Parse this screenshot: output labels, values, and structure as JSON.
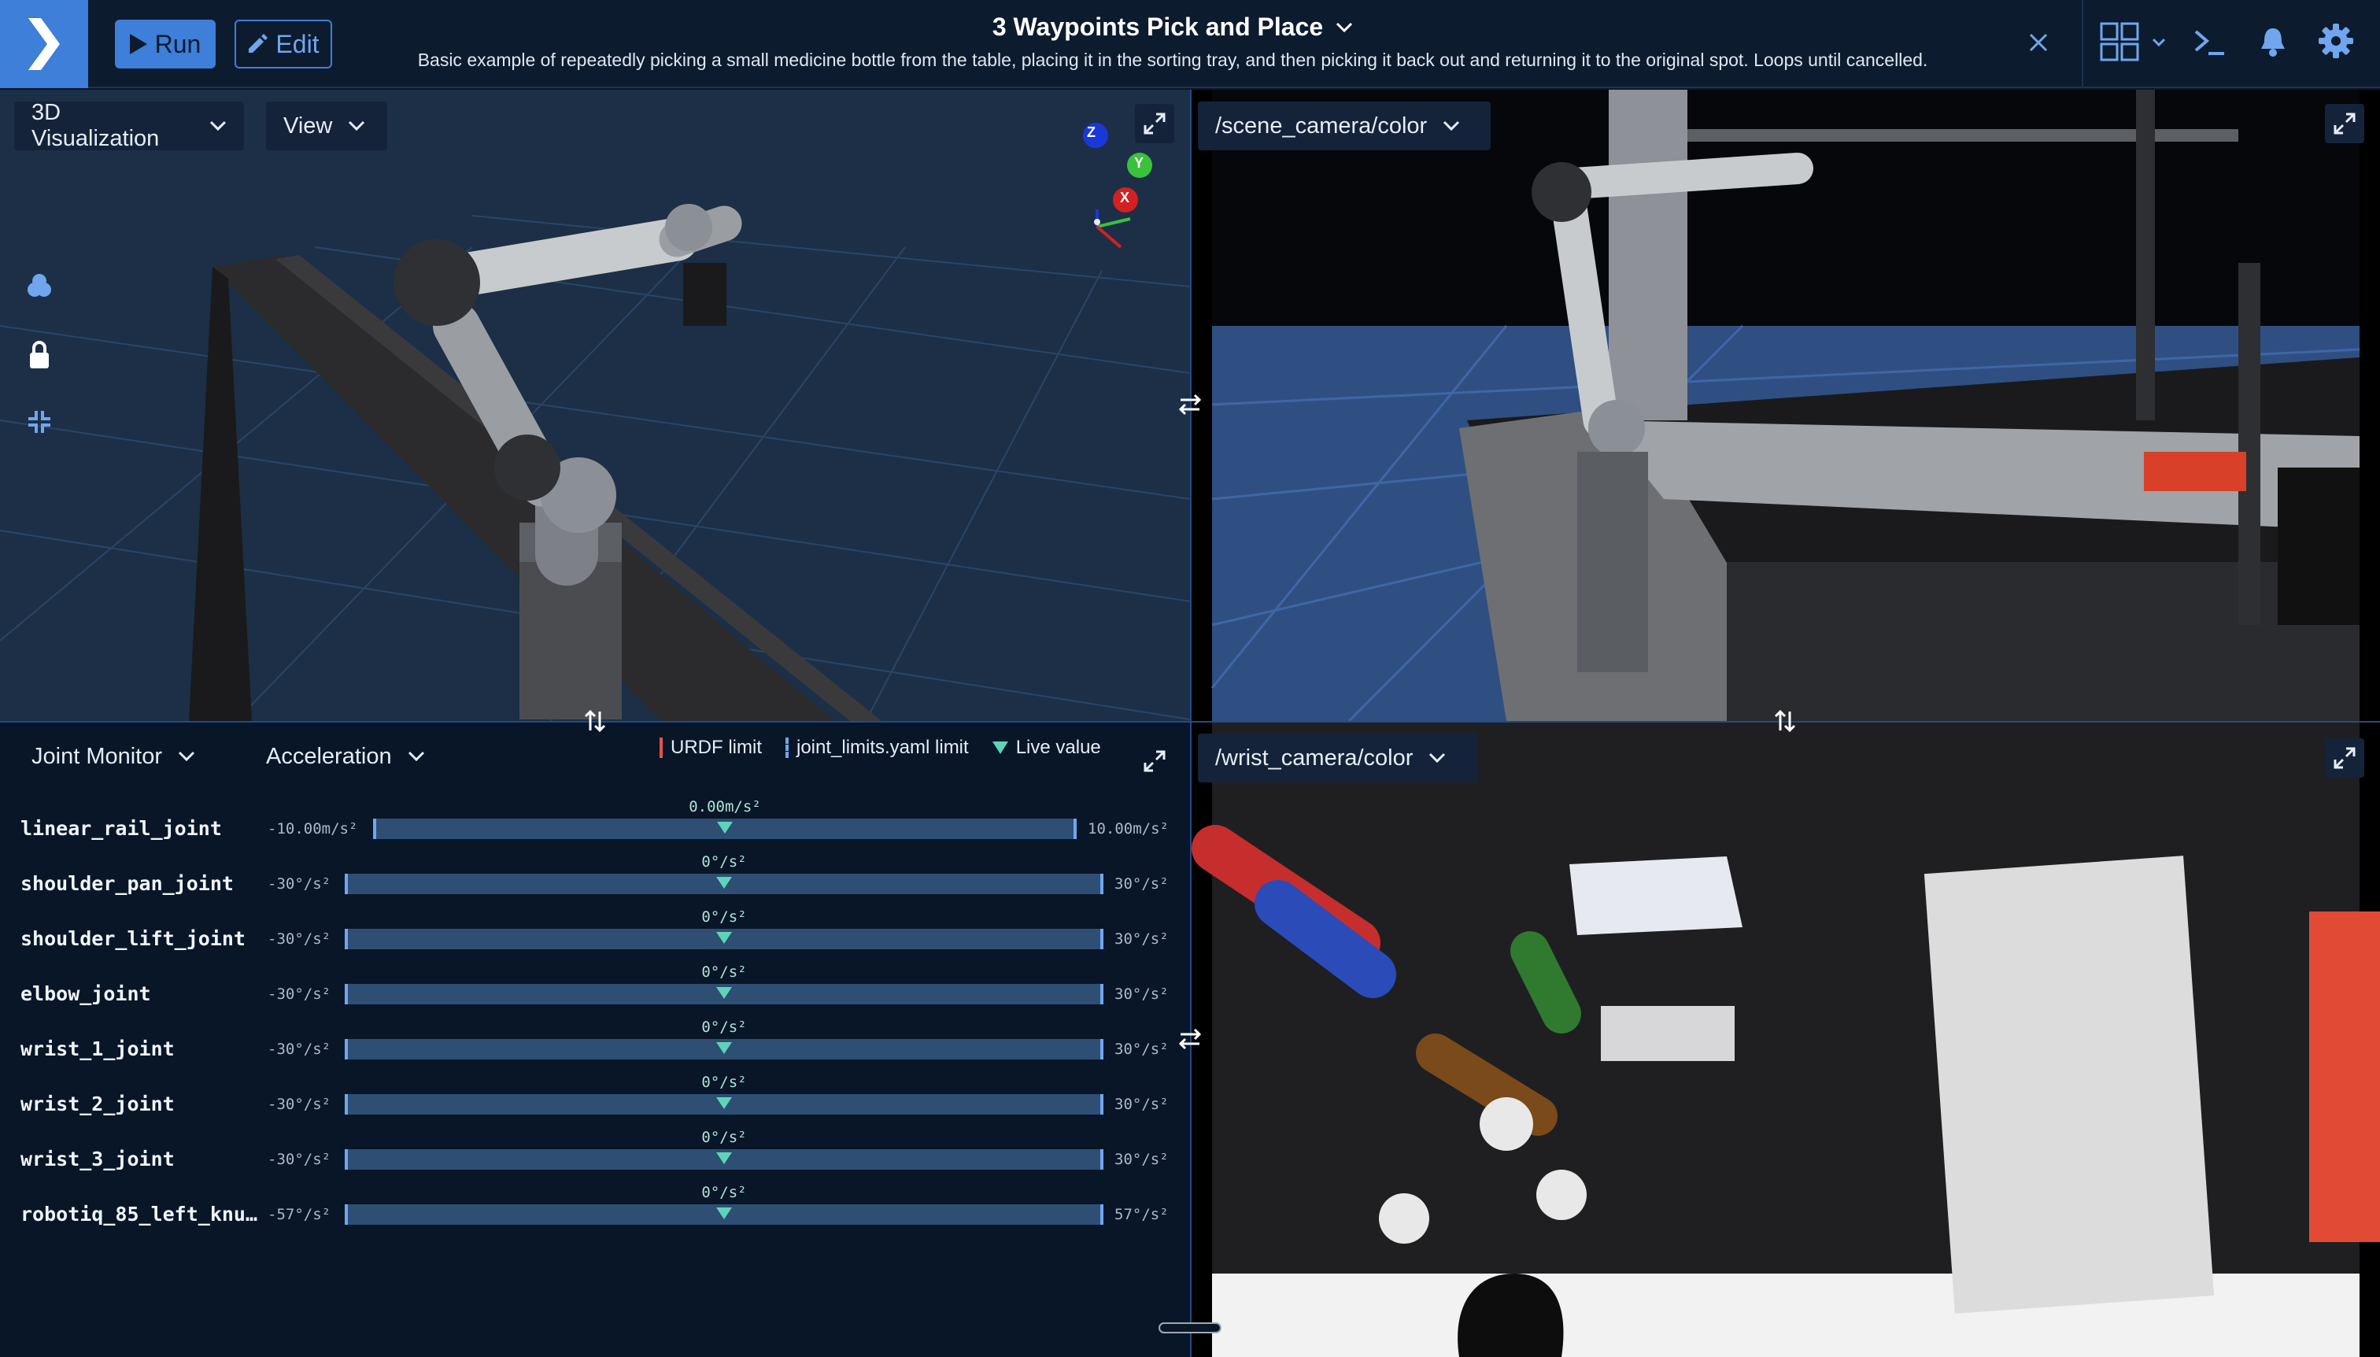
{
  "header": {
    "run_label": "Run",
    "edit_label": "Edit",
    "objective_title": "3 Waypoints Pick and Place",
    "objective_description": "Basic example of repeatedly picking a small medicine bottle from the table, placing it in the sorting tray, and then picking it back out and returning it to the original spot. Loops until cancelled.",
    "accent_color": "#3d7fd9",
    "background_color": "#0d1b2e"
  },
  "viz_panel": {
    "view_type_label": "3D Visualization",
    "view_menu_label": "View",
    "axes": {
      "z": "Z",
      "y": "Y",
      "x": "X"
    }
  },
  "scene_camera": {
    "topic_label": "/scene_camera/color"
  },
  "wrist_camera": {
    "topic_label": "/wrist_camera/color"
  },
  "joint_monitor": {
    "panel_label": "Joint Monitor",
    "mode_label": "Acceleration",
    "legend": {
      "urdf": "URDF limit",
      "yaml": "joint_limits.yaml limit",
      "live": "Live value"
    },
    "joints": [
      {
        "name": "linear_rail_joint",
        "min": "-10.00m/s²",
        "max": "10.00m/s²",
        "current": "0.00m/s²",
        "fraction": 0.5
      },
      {
        "name": "shoulder_pan_joint",
        "min": "-30°/s²",
        "max": "30°/s²",
        "current": "0°/s²",
        "fraction": 0.5
      },
      {
        "name": "shoulder_lift_joint",
        "min": "-30°/s²",
        "max": "30°/s²",
        "current": "0°/s²",
        "fraction": 0.5
      },
      {
        "name": "elbow_joint",
        "min": "-30°/s²",
        "max": "30°/s²",
        "current": "0°/s²",
        "fraction": 0.5
      },
      {
        "name": "wrist_1_joint",
        "min": "-30°/s²",
        "max": "30°/s²",
        "current": "0°/s²",
        "fraction": 0.5
      },
      {
        "name": "wrist_2_joint",
        "min": "-30°/s²",
        "max": "30°/s²",
        "current": "0°/s²",
        "fraction": 0.5
      },
      {
        "name": "wrist_3_joint",
        "min": "-30°/s²",
        "max": "30°/s²",
        "current": "0°/s²",
        "fraction": 0.5
      },
      {
        "name": "robotiq_85_left_knu…",
        "min": "-57°/s²",
        "max": "57°/s²",
        "current": "0°/s²",
        "fraction": 0.5
      }
    ]
  },
  "icons": {
    "logo": "chevron-logo-icon",
    "run": "play-icon",
    "edit": "pencil-icon",
    "close": "close-icon",
    "layout": "grid-layout-icon",
    "terminal": "terminal-icon",
    "notifications": "bell-icon",
    "settings": "gear-icon"
  }
}
